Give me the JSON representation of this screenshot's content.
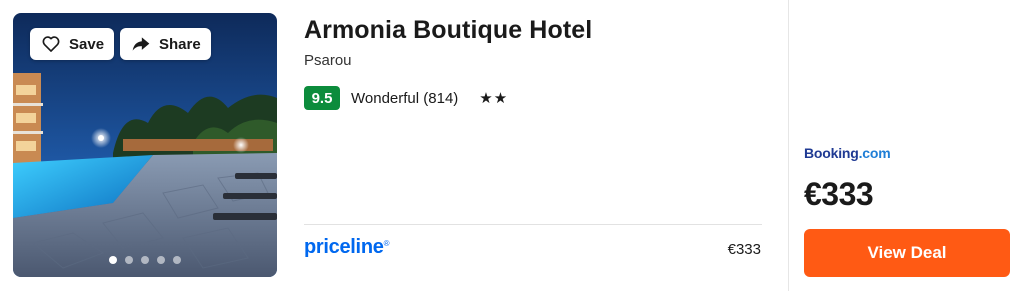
{
  "hotel": {
    "name": "Armonia Boutique Hotel",
    "location": "Psarou",
    "score": "9.5",
    "rating_text": "Wonderful (814)",
    "stars": "★★",
    "star_count": 2
  },
  "photo": {
    "save_label": "Save",
    "share_label": "Share",
    "carousel_total": 5,
    "carousel_active": 1,
    "icons": {
      "save": "heart-icon",
      "share": "share-arrow-icon"
    }
  },
  "offers": {
    "secondary": {
      "provider": "priceline",
      "registered_mark": "®",
      "price": "€333"
    },
    "featured": {
      "provider_main": "Booking",
      "provider_suffix": ".com",
      "price": "€333",
      "button_label": "View Deal"
    }
  },
  "colors": {
    "score_badge": "#0c8c3c",
    "priceline_blue": "#0068ef",
    "booking_navy": "#1f3a93",
    "deal_button": "#ff5a14"
  }
}
